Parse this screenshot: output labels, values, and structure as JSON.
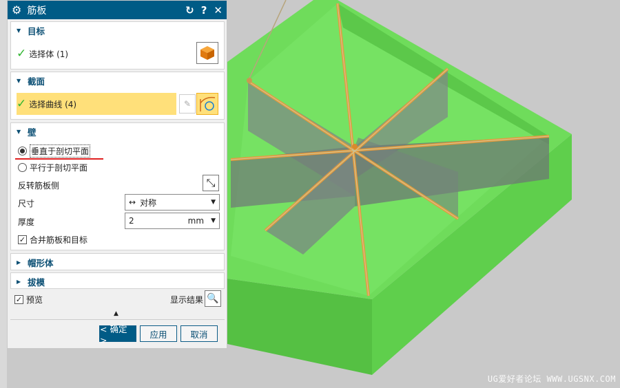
{
  "dialog": {
    "title": "筋板",
    "reset_icon": "reset-icon",
    "help_icon": "help-icon",
    "close_icon": "close-icon"
  },
  "target": {
    "header": "目标",
    "select_label": "选择体 (1)"
  },
  "section": {
    "header": "截面",
    "select_label": "选择曲线 (4)"
  },
  "wall": {
    "header": "壁",
    "radio_perpendicular": "垂直于剖切平面",
    "radio_parallel": "平行于剖切平面",
    "perpendicular_selected": true,
    "flip_label": "反转筋板侧",
    "size_label": "尺寸",
    "size_value": "对称",
    "thickness_label": "厚度",
    "thickness_value": "2",
    "thickness_unit": "mm",
    "merge_label": "合并筋板和目标",
    "merge_checked": true
  },
  "cap": {
    "header": "帽形体"
  },
  "draft": {
    "header": "拔模"
  },
  "footer": {
    "preview_label": "预览",
    "preview_checked": true,
    "show_result_label": "显示结果",
    "ok": "< 确定 >",
    "apply": "应用",
    "cancel": "取消"
  },
  "watermark": "UG爱好者论坛 WWW.UGSNX.COM",
  "colors": {
    "title_bar": "#005b86",
    "highlight": "#ffe07a",
    "model_green": "#6edc5a"
  }
}
